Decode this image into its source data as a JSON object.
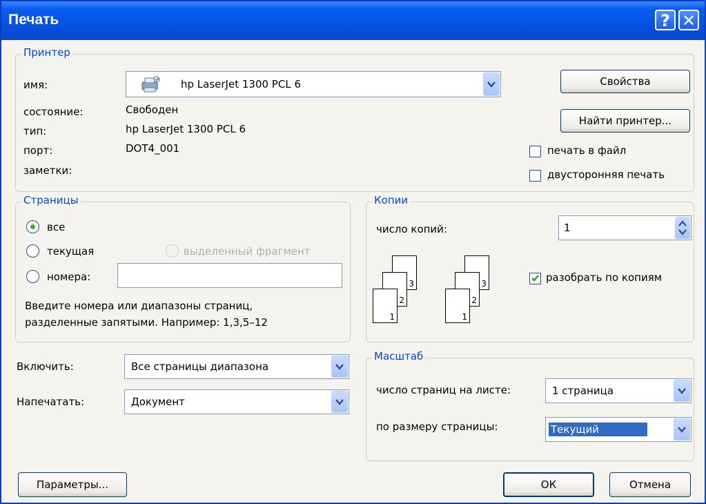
{
  "window": {
    "title": "Печать",
    "help_label": "?",
    "close_label": "✕"
  },
  "printer": {
    "legend": "Принтер",
    "name_label": "имя:",
    "name_value": "hp LaserJet 1300 PCL 6",
    "status_label": "состояние:",
    "status_value": "Свободен",
    "type_label": "тип:",
    "type_value": "hp LaserJet 1300 PCL 6",
    "port_label": "порт:",
    "port_value": "DOT4_001",
    "notes_label": "заметки:",
    "properties_button": "Свойства",
    "find_printer_button": "Найти принтер...",
    "print_to_file_label": "печать в файл",
    "print_to_file_checked": false,
    "duplex_label": "двусторонняя печать",
    "duplex_checked": false
  },
  "pages": {
    "legend": "Страницы",
    "all_label": "все",
    "current_label": "текущая",
    "selection_label": "выделенный фрагмент",
    "numbers_label": "номера:",
    "numbers_value": "",
    "selected_option": "все",
    "hint_line1": "Введите номера или диапазоны страниц,",
    "hint_line2": "разделенные запятыми. Например: 1,3,5–12"
  },
  "copies": {
    "legend": "Копии",
    "count_label": "число копий:",
    "count_value": "1",
    "collate_label": "разобрать по копиям",
    "collate_checked": true,
    "collated_pages": [
      "1",
      "2",
      "3"
    ],
    "uncollated_pages": [
      "1",
      "2",
      "3"
    ]
  },
  "include": {
    "label": "Включить:",
    "value": "Все страницы диапазона"
  },
  "print_what": {
    "label": "Напечатать:",
    "value": "Документ"
  },
  "scale": {
    "legend": "Масштаб",
    "pages_per_sheet_label": "число страниц на листе:",
    "pages_per_sheet_value": "1 страница",
    "fit_to_page_label": "по размеру страницы:",
    "fit_to_page_value": "Текущий"
  },
  "footer": {
    "options_button": "Параметры...",
    "ok_button": "ОК",
    "cancel_button": "Отмена"
  },
  "colors": {
    "accent": "#0046d5",
    "titlebar": "#0453e6",
    "selection": "#316ac5"
  }
}
